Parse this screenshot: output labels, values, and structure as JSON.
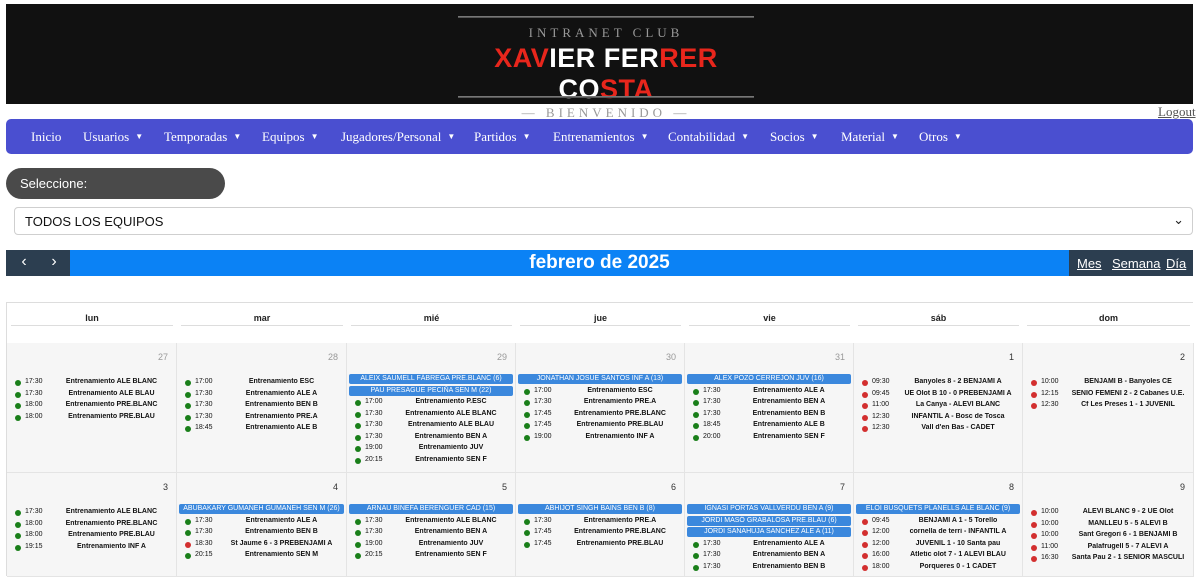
{
  "banner": {
    "top_line": "INTRANET CLUB",
    "title_parts": [
      "XAV",
      "IER FER",
      "RER",
      " CO",
      "STA"
    ],
    "sub_line": "— BIENVENIDO —"
  },
  "header": {
    "logout": "Logout"
  },
  "nav": [
    {
      "label": "Inicio",
      "caret": false
    },
    {
      "label": "Usuarios",
      "caret": true
    },
    {
      "label": "Temporadas",
      "caret": true
    },
    {
      "label": "Equipos",
      "caret": true
    },
    {
      "label": "Jugadores/Personal",
      "caret": true
    },
    {
      "label": "Partidos",
      "caret": true
    },
    {
      "label": "Entrenamientos",
      "caret": true
    },
    {
      "label": "Contabilidad",
      "caret": true
    },
    {
      "label": "Socios",
      "caret": true
    },
    {
      "label": "Material",
      "caret": true
    },
    {
      "label": "Otros",
      "caret": true
    }
  ],
  "filter": {
    "label": "Seleccione:",
    "selected": "TODOS LOS EQUIPOS"
  },
  "calendar": {
    "title": "febrero de 2025",
    "prev": "‹",
    "next": "›",
    "views": [
      "Mes",
      "Semana",
      "Día"
    ],
    "weekdays": [
      "lun",
      "mar",
      "mié",
      "jue",
      "vie",
      "sáb",
      "dom"
    ],
    "weeks": [
      [
        {
          "day": "27",
          "other": true,
          "bars": [],
          "events": [
            {
              "time": "17:30",
              "title": "Entrenamiento ALE BLANC",
              "color": "#1a7f1a"
            },
            {
              "time": "17:30",
              "title": "Entrenamiento ALE BLAU",
              "color": "#1a7f1a"
            },
            {
              "time": "18:00",
              "title": "Entrenamiento PRE.BLANC",
              "color": "#1a7f1a"
            },
            {
              "time": "18:00",
              "title": "Entrenamiento PRE.BLAU",
              "color": "#1a7f1a"
            }
          ]
        },
        {
          "day": "28",
          "other": true,
          "bars": [],
          "events": [
            {
              "time": "17:00",
              "title": "Entrenamiento ESC",
              "color": "#1a7f1a"
            },
            {
              "time": "17:30",
              "title": "Entrenamiento ALE A",
              "color": "#1a7f1a"
            },
            {
              "time": "17:30",
              "title": "Entrenamiento BEN B",
              "color": "#1a7f1a"
            },
            {
              "time": "17:30",
              "title": "Entrenamiento PRE.A",
              "color": "#1a7f1a"
            },
            {
              "time": "18:45",
              "title": "Entrenamiento ALE B",
              "color": "#1a7f1a"
            }
          ]
        },
        {
          "day": "29",
          "other": true,
          "bars": [
            "ALEIX SAUMELL FÁBREGA PRE.BLANC (6)",
            "PAU PRESAGUE PECIÑA SEN M (22)"
          ],
          "events": [
            {
              "time": "17:00",
              "title": "Entrenamiento P.ESC",
              "color": "#1a7f1a"
            },
            {
              "time": "17:30",
              "title": "Entrenamiento ALE BLANC",
              "color": "#1a7f1a"
            },
            {
              "time": "17:30",
              "title": "Entrenamiento ALE BLAU",
              "color": "#1a7f1a"
            },
            {
              "time": "17:30",
              "title": "Entrenamiento BEN A",
              "color": "#1a7f1a"
            },
            {
              "time": "19:00",
              "title": "Entrenamiento JUV",
              "color": "#1a7f1a"
            },
            {
              "time": "20:15",
              "title": "Entrenamiento SEN F",
              "color": "#1a7f1a"
            }
          ]
        },
        {
          "day": "30",
          "other": true,
          "bars": [
            "JONATHAN JOSUE SANTOS INF A (13)"
          ],
          "events": [
            {
              "time": "17:00",
              "title": "Entrenamiento ESC",
              "color": "#1a7f1a"
            },
            {
              "time": "17:30",
              "title": "Entrenamiento PRE.A",
              "color": "#1a7f1a"
            },
            {
              "time": "17:45",
              "title": "Entrenamiento PRE.BLANC",
              "color": "#1a7f1a"
            },
            {
              "time": "17:45",
              "title": "Entrenamiento PRE.BLAU",
              "color": "#1a7f1a"
            },
            {
              "time": "19:00",
              "title": "Entrenamiento INF A",
              "color": "#1a7f1a"
            }
          ]
        },
        {
          "day": "31",
          "other": true,
          "bars": [
            "ALEX POZO CERREJÓN JUV (16)"
          ],
          "events": [
            {
              "time": "17:30",
              "title": "Entrenamiento ALE A",
              "color": "#1a7f1a"
            },
            {
              "time": "17:30",
              "title": "Entrenamiento BEN A",
              "color": "#1a7f1a"
            },
            {
              "time": "17:30",
              "title": "Entrenamiento BEN B",
              "color": "#1a7f1a"
            },
            {
              "time": "18:45",
              "title": "Entrenamiento ALE B",
              "color": "#1a7f1a"
            },
            {
              "time": "20:00",
              "title": "Entrenamiento SEN F",
              "color": "#1a7f1a"
            }
          ]
        },
        {
          "day": "1",
          "other": false,
          "bars": [],
          "events": [
            {
              "time": "09:30",
              "title": "Banyoles 8 - 2 BENJAMI A",
              "color": "#d32f2f"
            },
            {
              "time": "09:45",
              "title": "UE Olot B 10 - 0 PREBENJAMI A",
              "color": "#d32f2f"
            },
            {
              "time": "11:00",
              "title": "La Canya - ALEVI BLANC",
              "color": "#d32f2f"
            },
            {
              "time": "12:30",
              "title": "INFANTIL A - Bosc de Tosca",
              "color": "#d32f2f"
            },
            {
              "time": "12:30",
              "title": "Vall d'en Bas - CADET",
              "color": "#d32f2f"
            }
          ]
        },
        {
          "day": "2",
          "other": false,
          "bars": [],
          "events": [
            {
              "time": "10:00",
              "title": "BENJAMI B - Banyoles CE",
              "color": "#d32f2f"
            },
            {
              "time": "12:15",
              "title": "SÈNIO FEMENI 2 - 2 Cabanes U.E.",
              "color": "#d32f2f"
            },
            {
              "time": "12:30",
              "title": "Cf Les Preses 1 - 1 JUVENIL",
              "color": "#d32f2f"
            }
          ]
        }
      ],
      [
        {
          "day": "3",
          "other": false,
          "bars": [],
          "events": [
            {
              "time": "17:30",
              "title": "Entrenamiento ALE BLANC",
              "color": "#1a7f1a"
            },
            {
              "time": "18:00",
              "title": "Entrenamiento PRE.BLANC",
              "color": "#1a7f1a"
            },
            {
              "time": "18:00",
              "title": "Entrenamiento PRE.BLAU",
              "color": "#1a7f1a"
            },
            {
              "time": "19:15",
              "title": "Entrenamiento INF A",
              "color": "#1a7f1a"
            }
          ]
        },
        {
          "day": "4",
          "other": false,
          "bars": [
            "ABUBAKARY GUMANEH GUMANEH SEN M (26)"
          ],
          "events": [
            {
              "time": "17:30",
              "title": "Entrenamiento ALE A",
              "color": "#1a7f1a"
            },
            {
              "time": "17:30",
              "title": "Entrenamiento BEN B",
              "color": "#1a7f1a"
            },
            {
              "time": "18:30",
              "title": "St Jaume 6 - 3 PREBENJAMI A",
              "color": "#d32f2f"
            },
            {
              "time": "20:15",
              "title": "Entrenamiento SEN M",
              "color": "#1a7f1a"
            }
          ]
        },
        {
          "day": "5",
          "other": false,
          "bars": [
            "ARNAU BINEFA BERENGUER CAD (15)"
          ],
          "events": [
            {
              "time": "17:30",
              "title": "Entrenamiento ALE BLANC",
              "color": "#1a7f1a"
            },
            {
              "time": "17:30",
              "title": "Entrenamiento BEN A",
              "color": "#1a7f1a"
            },
            {
              "time": "19:00",
              "title": "Entrenamiento JUV",
              "color": "#1a7f1a"
            },
            {
              "time": "20:15",
              "title": "Entrenamiento SEN F",
              "color": "#1a7f1a"
            }
          ]
        },
        {
          "day": "6",
          "other": false,
          "bars": [
            "ABHIJOT SINGH BAINS BEN B (8)"
          ],
          "events": [
            {
              "time": "17:30",
              "title": "Entrenamiento PRE.A",
              "color": "#1a7f1a"
            },
            {
              "time": "17:45",
              "title": "Entrenamiento PRE.BLANC",
              "color": "#1a7f1a"
            },
            {
              "time": "17:45",
              "title": "Entrenamiento PRE.BLAU",
              "color": "#1a7f1a"
            }
          ]
        },
        {
          "day": "7",
          "other": false,
          "bars": [
            "IGNASI PORTAS VALLVERDÚ BEN A (9)",
            "JORDI MASÓ GRABALOSA PRE.BLAU (6)",
            "JORDI SANAHUJA SANCHEZ ALE A (11)"
          ],
          "events": [
            {
              "time": "17:30",
              "title": "Entrenamiento ALE A",
              "color": "#1a7f1a"
            },
            {
              "time": "17:30",
              "title": "Entrenamiento BEN A",
              "color": "#1a7f1a"
            },
            {
              "time": "17:30",
              "title": "Entrenamiento BEN B",
              "color": "#1a7f1a"
            }
          ]
        },
        {
          "day": "8",
          "other": false,
          "bars": [
            "ELOI BUSQUETS PLANELLS ALE BLANC (9)"
          ],
          "events": [
            {
              "time": "09:45",
              "title": "BENJAMI A 1 - 5 Torello",
              "color": "#d32f2f"
            },
            {
              "time": "12:00",
              "title": "cornella de terri - INFANTIL A",
              "color": "#d32f2f"
            },
            {
              "time": "12:00",
              "title": "JUVENIL 1 - 10 Santa pau",
              "color": "#d32f2f"
            },
            {
              "time": "16:00",
              "title": "Atletic olot 7 - 1 ALEVI BLAU",
              "color": "#d32f2f"
            },
            {
              "time": "18:00",
              "title": "Porqueres 0 - 1 CADET",
              "color": "#d32f2f"
            }
          ]
        },
        {
          "day": "9",
          "other": false,
          "bars": [],
          "events": [
            {
              "time": "10:00",
              "title": "ALEVI BLANC 9 - 2 UE Olot",
              "color": "#d32f2f"
            },
            {
              "time": "10:00",
              "title": "MANLLEU 5 - 5 ALEVI B",
              "color": "#d32f2f"
            },
            {
              "time": "10:00",
              "title": "Sant Gregori 6 - 1 BENJAMI B",
              "color": "#d32f2f"
            },
            {
              "time": "11:00",
              "title": "Palafrugell 5 - 7 ALEVI A",
              "color": "#d32f2f"
            },
            {
              "time": "16:30",
              "title": "Santa Pau 2 - 1 SENIOR MASCULI",
              "color": "#d32f2f"
            }
          ]
        }
      ]
    ]
  }
}
